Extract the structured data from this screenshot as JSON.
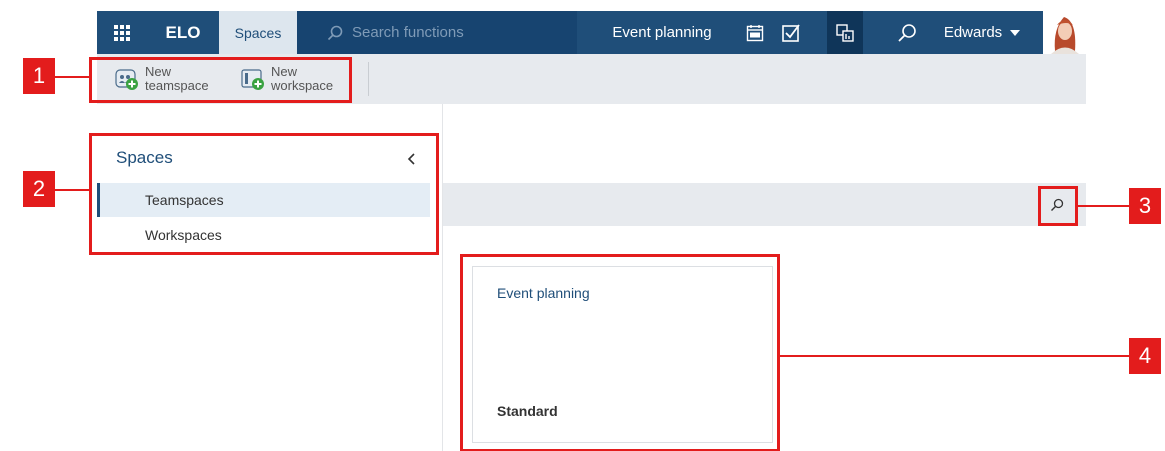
{
  "topbar": {
    "logo": "ELO",
    "active_tab": "Spaces",
    "search_placeholder": "Search functions",
    "current_space": "Event planning",
    "user_name": "Edwards"
  },
  "ribbon": {
    "new_teamspace": [
      "New",
      "teamspace"
    ],
    "new_workspace": [
      "New",
      "workspace"
    ]
  },
  "nav": {
    "title": "Spaces",
    "items": [
      {
        "label": "Teamspaces",
        "active": true
      },
      {
        "label": "Workspaces",
        "active": false
      }
    ]
  },
  "cards": [
    {
      "title": "Event planning",
      "subtitle": "Standard"
    }
  ],
  "annotations": [
    "1",
    "2",
    "3",
    "4"
  ],
  "colors": {
    "brand": "#1f4e79",
    "annotation": "#e31c1c",
    "ribbon": "#e7eaee"
  }
}
